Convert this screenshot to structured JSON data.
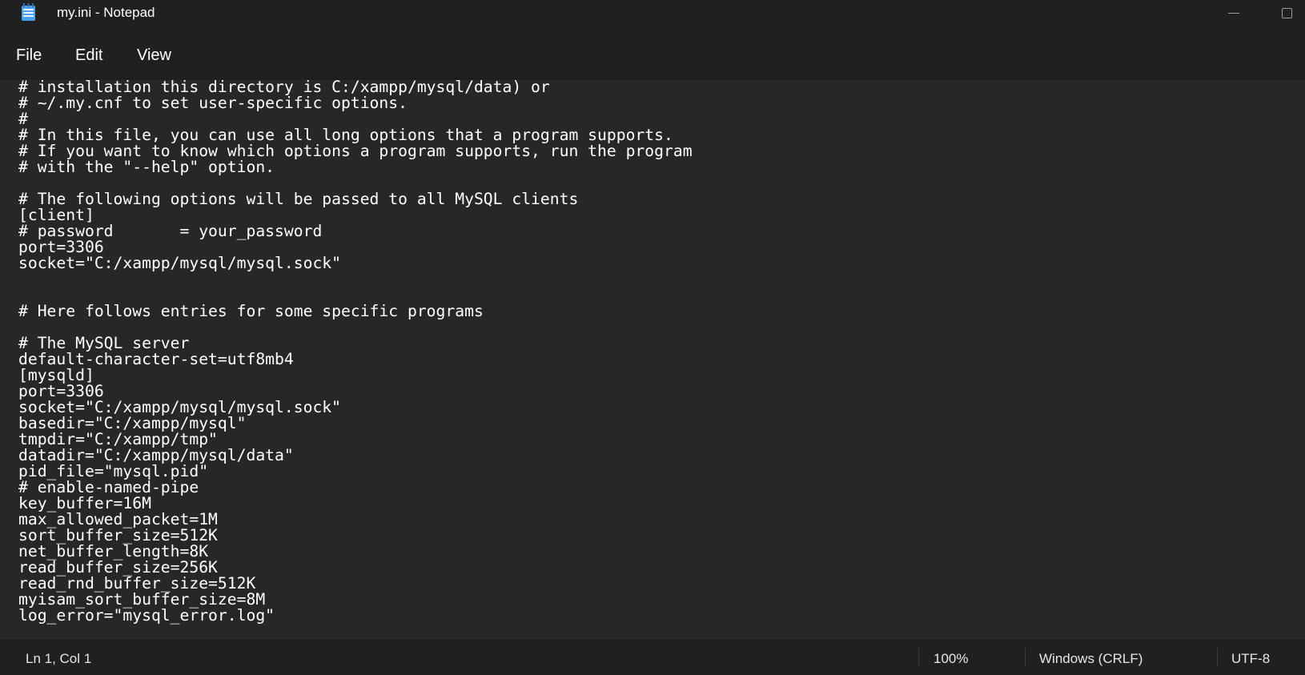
{
  "window": {
    "title": "my.ini - Notepad",
    "app_icon": "notepad-icon"
  },
  "menu": {
    "file": "File",
    "edit": "Edit",
    "view": "View"
  },
  "editor": {
    "lines": [
      "# installation this directory is C:/xampp/mysql/data) or",
      "# ~/.my.cnf to set user-specific options.",
      "#",
      "# In this file, you can use all long options that a program supports.",
      "# If you want to know which options a program supports, run the program",
      "# with the \"--help\" option.",
      "",
      "# The following options will be passed to all MySQL clients",
      "[client]",
      "# password       = your_password",
      "port=3306",
      "socket=\"C:/xampp/mysql/mysql.sock\"",
      "",
      "",
      "# Here follows entries for some specific programs",
      "",
      "# The MySQL server",
      "default-character-set=utf8mb4",
      "[mysqld]",
      "port=3306",
      "socket=\"C:/xampp/mysql/mysql.sock\"",
      "basedir=\"C:/xampp/mysql\"",
      "tmpdir=\"C:/xampp/tmp\"",
      "datadir=\"C:/xampp/mysql/data\"",
      "pid_file=\"mysql.pid\"",
      "# enable-named-pipe",
      "key_buffer=16M",
      "max_allowed_packet=1M",
      "sort_buffer_size=512K",
      "net_buffer_length=8K",
      "read_buffer_size=256K",
      "read_rnd_buffer_size=512K",
      "myisam_sort_buffer_size=8M",
      "log_error=\"mysql_error.log\""
    ]
  },
  "status": {
    "position": "Ln 1, Col 1",
    "zoom": "100%",
    "line_ending": "Windows (CRLF)",
    "encoding": "UTF-8"
  },
  "colors": {
    "background": "#272727",
    "chrome": "#202020",
    "text": "#ffffff",
    "icon_accent": "#3a8ee6"
  }
}
